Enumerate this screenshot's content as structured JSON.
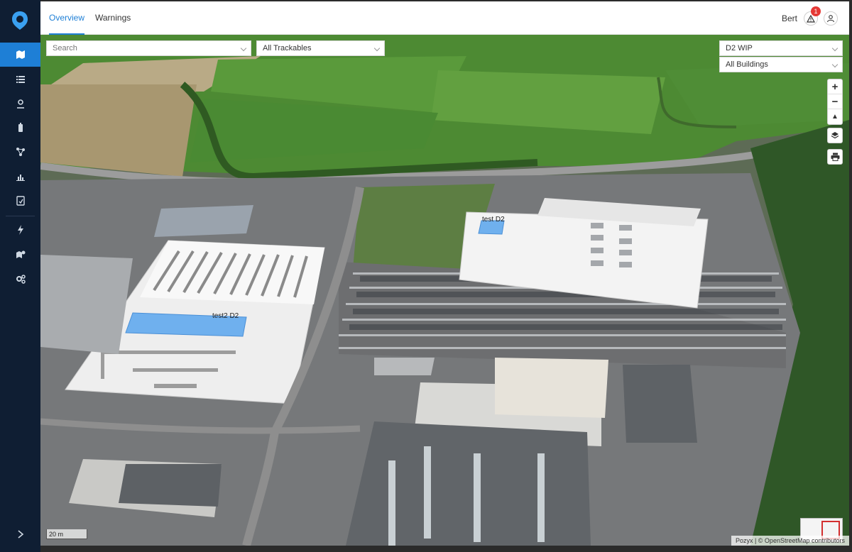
{
  "sidebar": {
    "items": [
      {
        "name": "map-icon",
        "active": true
      },
      {
        "name": "list-icon"
      },
      {
        "name": "location-pin-icon"
      },
      {
        "name": "tag-device-icon"
      },
      {
        "name": "network-icon"
      },
      {
        "name": "bar-chart-icon"
      },
      {
        "name": "report-icon"
      },
      {
        "name": "lightning-icon"
      },
      {
        "name": "map-settings-icon"
      },
      {
        "name": "gears-icon"
      }
    ],
    "expand_icon": "chevron-right-icon"
  },
  "header": {
    "tabs": [
      {
        "label": "Overview",
        "active": true
      },
      {
        "label": "Warnings",
        "active": false
      }
    ],
    "user_name": "Bert",
    "notification_count": "1"
  },
  "filters": {
    "search_placeholder": "Search",
    "trackables": "All Trackables",
    "site": "D2 WIP",
    "buildings": "All Buildings"
  },
  "map": {
    "zoom_in": "+",
    "zoom_out": "−",
    "reset_north": "▲",
    "labels": {
      "building_a": "test2 D2",
      "building_b": "test D2"
    },
    "scale": "20 m",
    "attribution": "Pozyx | © OpenStreetMap contributors",
    "colors": {
      "accent": "#1e7fd6",
      "zone": "#6fb0ee",
      "sidebar": "#0f1e33"
    }
  }
}
